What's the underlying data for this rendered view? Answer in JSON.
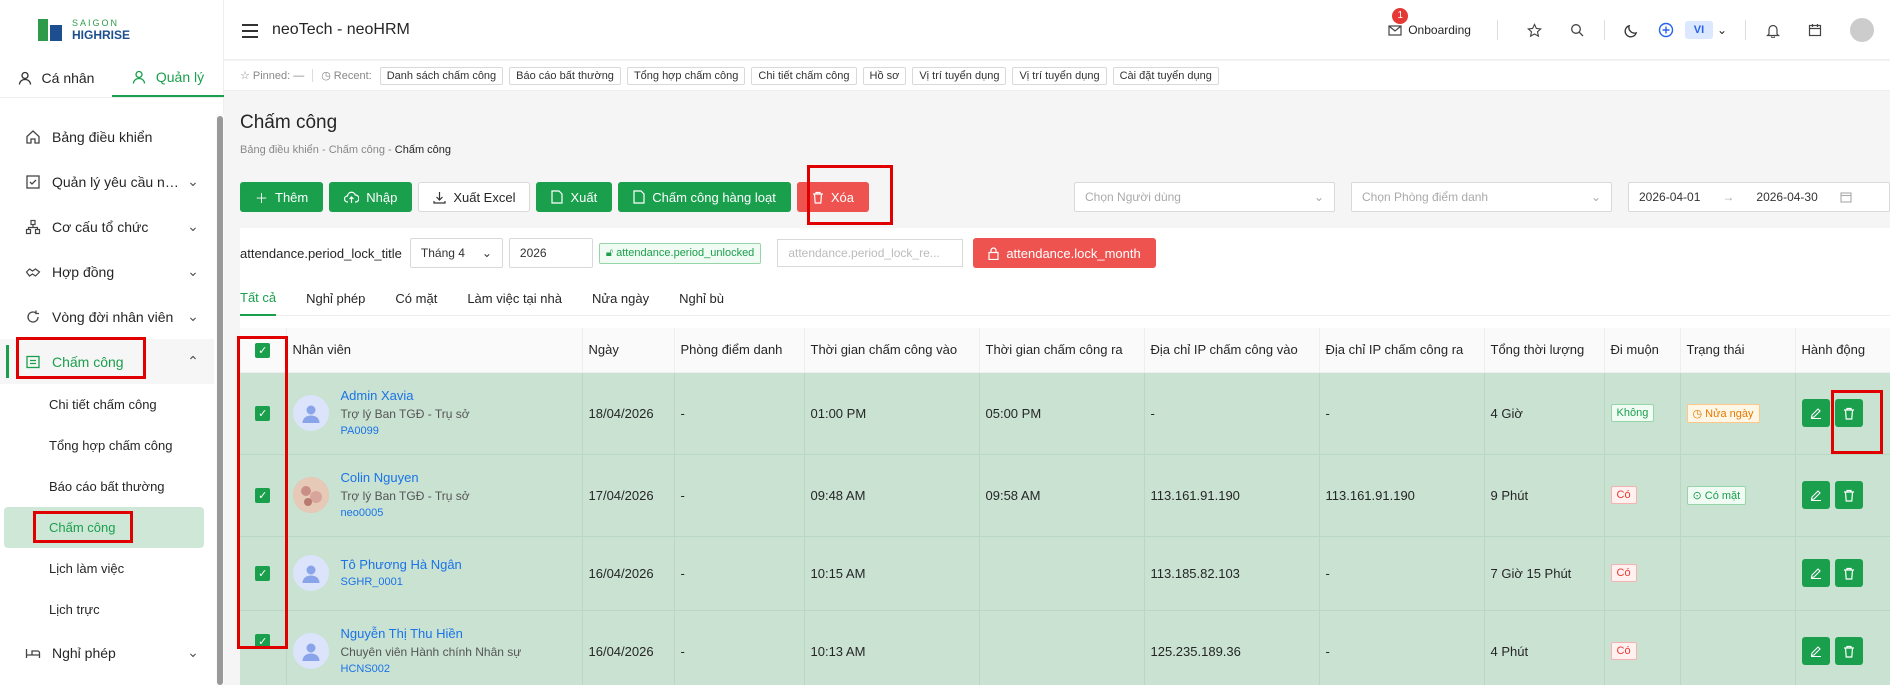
{
  "brand": {
    "line1": "SAIGON",
    "line2": "HIGHRISE"
  },
  "role_tabs": [
    {
      "label": "Cá nhân",
      "icon": "person-icon"
    },
    {
      "label": "Quản lý",
      "icon": "person-icon"
    }
  ],
  "menu": {
    "items_top": [
      "Bảng điều khiển",
      "Quản lý yêu cầu nhân viên",
      "Cơ cấu tổ chức",
      "Hợp đồng",
      "Vòng đời nhân viên"
    ],
    "open": "Chấm công",
    "subitems": [
      "Chi tiết chấm công",
      "Tổng hợp chấm công",
      "Báo cáo bất thường",
      "Chấm công",
      "Lịch làm việc",
      "Lịch trực"
    ],
    "items_bottom": [
      "Nghỉ phép"
    ]
  },
  "header": {
    "title": "neoTech - neoHRM",
    "onboarding": "Onboarding",
    "badge_count": "1",
    "lang": "VI"
  },
  "recent": {
    "pinned_label": "Pinned:",
    "pinned_value": "—",
    "recent_label": "Recent:",
    "chips": [
      "Danh sách chấm công",
      "Báo cáo bất thường",
      "Tổng hợp chấm công",
      "Chi tiết chấm công",
      "Hồ sơ",
      "Vị trí tuyển dụng",
      "Vị trí tuyển dụng",
      "Cài đặt tuyển dụng"
    ]
  },
  "page": {
    "title": "Chấm công",
    "breadcrumb": [
      "Bảng điều khiển",
      "Chấm công",
      "Chấm công"
    ]
  },
  "toolbar": {
    "add": "Thêm",
    "import": "Nhập",
    "export_excel": "Xuất Excel",
    "export": "Xuất",
    "bulk": "Chấm công hàng loạt",
    "delete": "Xóa"
  },
  "filters": {
    "user_placeholder": "Chọn Người dùng",
    "room_placeholder": "Chọn Phòng điểm danh",
    "date_from": "2026-04-01",
    "date_to": "2026-04-30"
  },
  "period": {
    "title": "attendance.period_lock_title",
    "month": "Tháng 4",
    "year": "2026",
    "status": "attendance.period_unlocked",
    "reason_placeholder": "attendance.period_lock_re...",
    "lock_button": "attendance.lock_month"
  },
  "tabs": [
    "Tất cả",
    "Nghỉ phép",
    "Có mặt",
    "Làm việc tại nhà",
    "Nửa ngày",
    "Nghỉ bù"
  ],
  "table": {
    "headers": [
      "Nhân viên",
      "Ngày",
      "Phòng điểm danh",
      "Thời gian chấm công vào",
      "Thời gian chấm công ra",
      "Địa chỉ IP chấm công vào",
      "Địa chỉ IP chấm công ra",
      "Tổng thời lượng",
      "Đi muộn",
      "Trạng thái",
      "Hành động"
    ],
    "rows": [
      {
        "name": "Admin Xavia",
        "position": "Trợ lý Ban TGĐ - Trụ sở",
        "code": "PA0099",
        "date": "18/04/2026",
        "room": "-",
        "in": "01:00 PM",
        "out": "05:00 PM",
        "ip_in": "-",
        "ip_out": "-",
        "total": "4 Giờ",
        "late": "Không",
        "status": "Nửa ngày"
      },
      {
        "name": "Colin Nguyen",
        "position": "Trợ lý Ban TGĐ - Trụ sở",
        "code": "neo0005",
        "date": "17/04/2026",
        "room": "-",
        "in": "09:48 AM",
        "out": "09:58 AM",
        "ip_in": "113.161.91.190",
        "ip_out": "113.161.91.190",
        "total": "9 Phút",
        "late": "Có",
        "status": "Có mặt"
      },
      {
        "name": "Tô Phương Hà Ngân",
        "position": "",
        "code": "SGHR_0001",
        "date": "16/04/2026",
        "room": "-",
        "in": "10:15 AM",
        "out": "",
        "ip_in": "113.185.82.103",
        "ip_out": "-",
        "total": "7 Giờ 15 Phút",
        "late": "Có",
        "status": ""
      },
      {
        "name": "Nguyễn Thị Thu Hiền",
        "position": "Chuyên viên Hành chính Nhân sự",
        "code": "HCNS002",
        "date": "16/04/2026",
        "room": "-",
        "in": "10:13 AM",
        "out": "",
        "ip_in": "125.235.189.36",
        "ip_out": "-",
        "total": "4 Phút",
        "late": "Có",
        "status": ""
      }
    ]
  },
  "colors": {
    "primary": "#1a9f4d",
    "danger": "#ef5350",
    "highlight": "#e00000",
    "selected_row": "#c9e2d2"
  }
}
